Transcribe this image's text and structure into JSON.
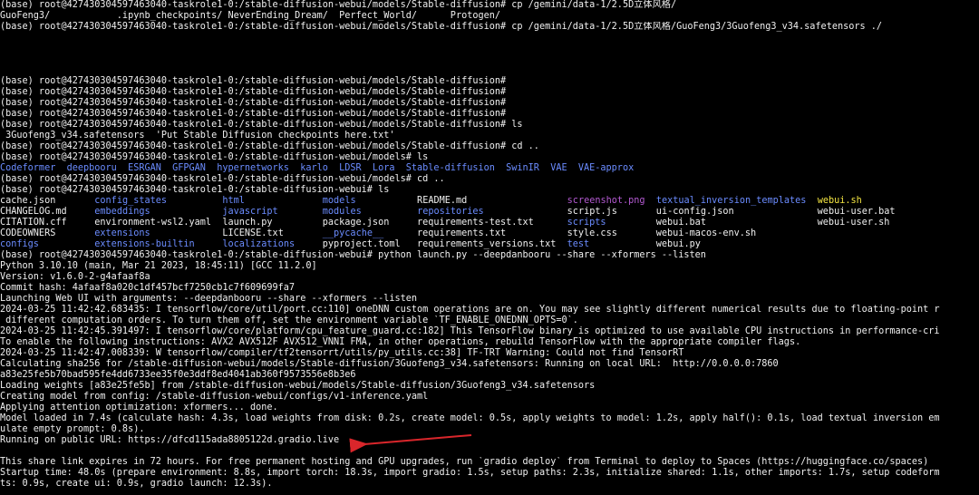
{
  "colors": {
    "background": "#000000",
    "text": "#f0f0f0",
    "dir": "#6b8cff",
    "image_file": "#b45ad2",
    "script_file": "#f5e642",
    "arrow": "#d9262b"
  },
  "annotation": {
    "type": "red-arrow-pointing-left"
  },
  "lines": [
    [
      {
        "t": "(base) root@427430304597463040-taskrole1-0:/stable-diffusion-webui/models/Stable-diffusion# cp /gemini/data-1/2.5D立体风格/"
      }
    ],
    [
      {
        "t": "GuoFeng3/            .ipynb_checkpoints/ NeverEnding_Dream/  Perfect_World/      Protogen/"
      }
    ],
    [
      {
        "t": "(base) root@427430304597463040-taskrole1-0:/stable-diffusion-webui/models/Stable-diffusion# cp /gemini/data-1/2.5D立体风格/GuoFeng3/3Guofeng3_v34.safetensors ./"
      }
    ],
    [
      {
        "t": ""
      }
    ],
    [
      {
        "t": ""
      }
    ],
    [
      {
        "t": ""
      }
    ],
    [
      {
        "t": ""
      }
    ],
    [
      {
        "t": "(base) root@427430304597463040-taskrole1-0:/stable-diffusion-webui/models/Stable-diffusion#"
      }
    ],
    [
      {
        "t": "(base) root@427430304597463040-taskrole1-0:/stable-diffusion-webui/models/Stable-diffusion#"
      }
    ],
    [
      {
        "t": "(base) root@427430304597463040-taskrole1-0:/stable-diffusion-webui/models/Stable-diffusion#"
      }
    ],
    [
      {
        "t": "(base) root@427430304597463040-taskrole1-0:/stable-diffusion-webui/models/Stable-diffusion#"
      }
    ],
    [
      {
        "t": "(base) root@427430304597463040-taskrole1-0:/stable-diffusion-webui/models/Stable-diffusion# ls"
      }
    ],
    [
      {
        "t": " 3Guofeng3_v34.safetensors  'Put Stable Diffusion checkpoints here.txt'"
      }
    ],
    [
      {
        "t": "(base) root@427430304597463040-taskrole1-0:/stable-diffusion-webui/models/Stable-diffusion# cd .."
      }
    ],
    [
      {
        "t": "(base) root@427430304597463040-taskrole1-0:/stable-diffusion-webui/models# ls"
      }
    ],
    [
      {
        "t": "Codeformer  deepbooru  ESRGAN  GFPGAN  hypernetworks  karlo  LDSR  Lora  Stable-diffusion  SwinIR  VAE  VAE-approx",
        "c": "blue"
      }
    ],
    [
      {
        "t": "(base) root@427430304597463040-taskrole1-0:/stable-diffusion-webui/models# cd .."
      }
    ],
    [
      {
        "t": "(base) root@427430304597463040-taskrole1-0:/stable-diffusion-webui# ls"
      }
    ],
    [
      {
        "t": "cache.json       "
      },
      {
        "t": "config_states",
        "c": "blue"
      },
      {
        "t": "          "
      },
      {
        "t": "html",
        "c": "blue"
      },
      {
        "t": "              "
      },
      {
        "t": "models",
        "c": "blue"
      },
      {
        "t": "           README.md                  "
      },
      {
        "t": "screenshot.png",
        "c": "purple"
      },
      {
        "t": "  "
      },
      {
        "t": "textual_inversion_templates",
        "c": "blue"
      },
      {
        "t": "  "
      },
      {
        "t": "webui.sh",
        "c": "yellow"
      }
    ],
    [
      {
        "t": "CHANGELOG.md     "
      },
      {
        "t": "embeddings",
        "c": "blue"
      },
      {
        "t": "             "
      },
      {
        "t": "javascript",
        "c": "blue"
      },
      {
        "t": "        "
      },
      {
        "t": "modules",
        "c": "blue"
      },
      {
        "t": "          "
      },
      {
        "t": "repositories",
        "c": "blue"
      },
      {
        "t": "               script.js       ui-config.json               webui-user.bat"
      }
    ],
    [
      {
        "t": "CITATION.cff     environment-wsl2.yaml  launch.py         package.json     requirements-test.txt      "
      },
      {
        "t": "scripts",
        "c": "blue"
      },
      {
        "t": "         webui.bat                    webui-user.sh"
      }
    ],
    [
      {
        "t": "CODEOWNERS       "
      },
      {
        "t": "extensions",
        "c": "blue"
      },
      {
        "t": "             LICENSE.txt       "
      },
      {
        "t": "__pycache__",
        "c": "blue"
      },
      {
        "t": "      requirements.txt           style.css       webui-macos-env.sh"
      }
    ],
    [
      {
        "t": "configs",
        "c": "blue"
      },
      {
        "t": "          "
      },
      {
        "t": "extensions-builtin",
        "c": "blue"
      },
      {
        "t": "     "
      },
      {
        "t": "localizations",
        "c": "blue"
      },
      {
        "t": "     pyproject.toml   requirements_versions.txt  "
      },
      {
        "t": "test",
        "c": "blue"
      },
      {
        "t": "            webui.py"
      }
    ],
    [
      {
        "t": "(base) root@427430304597463040-taskrole1-0:/stable-diffusion-webui# python launch.py --deepdanbooru --share --xformers --listen"
      }
    ],
    [
      {
        "t": "Python 3.10.10 (main, Mar 21 2023, 18:45:11) [GCC 11.2.0]"
      }
    ],
    [
      {
        "t": "Version: v1.6.0-2-g4afaaf8a"
      }
    ],
    [
      {
        "t": "Commit hash: 4afaaf8a020c1df457bcf7250cb1c7f609699fa7"
      }
    ],
    [
      {
        "t": "Launching Web UI with arguments: --deepdanbooru --share --xformers --listen"
      }
    ],
    [
      {
        "t": "2024-03-25 11:42:42.683435: I tensorflow/core/util/port.cc:110] oneDNN custom operations are on. You may see slightly different numerical results due to floating-point r"
      }
    ],
    [
      {
        "t": " different computation orders. To turn them off, set the environment variable `TF_ENABLE_ONEDNN_OPTS=0`."
      }
    ],
    [
      {
        "t": "2024-03-25 11:42:45.391497: I tensorflow/core/platform/cpu_feature_guard.cc:182] This TensorFlow binary is optimized to use available CPU instructions in performance-cri"
      }
    ],
    [
      {
        "t": "To enable the following instructions: AVX2 AVX512F AVX512_VNNI FMA, in other operations, rebuild TensorFlow with the appropriate compiler flags."
      }
    ],
    [
      {
        "t": "2024-03-25 11:42:47.008339: W tensorflow/compiler/tf2tensorrt/utils/py_utils.cc:38] TF-TRT Warning: Could not find TensorRT"
      }
    ],
    [
      {
        "t": "Calculating sha256 for /stable-diffusion-webui/models/Stable-diffusion/3Guofeng3_v34.safetensors: Running on local URL:  http://0.0.0.0:7860"
      }
    ],
    [
      {
        "t": "a83e25fe5b70bad595fe4dd6733ee35f0e3ddf8ed4041ab360f9573556e8b3e6"
      }
    ],
    [
      {
        "t": "Loading weights [a83e25fe5b] from /stable-diffusion-webui/models/Stable-diffusion/3Guofeng3_v34.safetensors"
      }
    ],
    [
      {
        "t": "Creating model from config: /stable-diffusion-webui/configs/v1-inference.yaml"
      }
    ],
    [
      {
        "t": "Applying attention optimization: xformers... done."
      }
    ],
    [
      {
        "t": "Model loaded in 7.4s (calculate hash: 4.3s, load weights from disk: 0.2s, create model: 0.5s, apply weights to model: 1.2s, apply half(): 0.1s, load textual inversion em"
      }
    ],
    [
      {
        "t": "ulate empty prompt: 0.8s)."
      }
    ],
    [
      {
        "t": "Running on public URL: https://dfcd115ada8805122d.gradio.live"
      }
    ],
    [
      {
        "t": ""
      }
    ],
    [
      {
        "t": "This share link expires in 72 hours. For free permanent hosting and GPU upgrades, run `gradio deploy` from Terminal to deploy to Spaces (https://huggingface.co/spaces)"
      }
    ],
    [
      {
        "t": "Startup time: 48.0s (prepare environment: 8.8s, import torch: 18.3s, import gradio: 1.5s, setup paths: 2.3s, initialize shared: 1.1s, other imports: 1.7s, setup codeform"
      }
    ],
    [
      {
        "t": "ts: 0.9s, create ui: 0.9s, gradio launch: 12.3s)."
      }
    ]
  ]
}
